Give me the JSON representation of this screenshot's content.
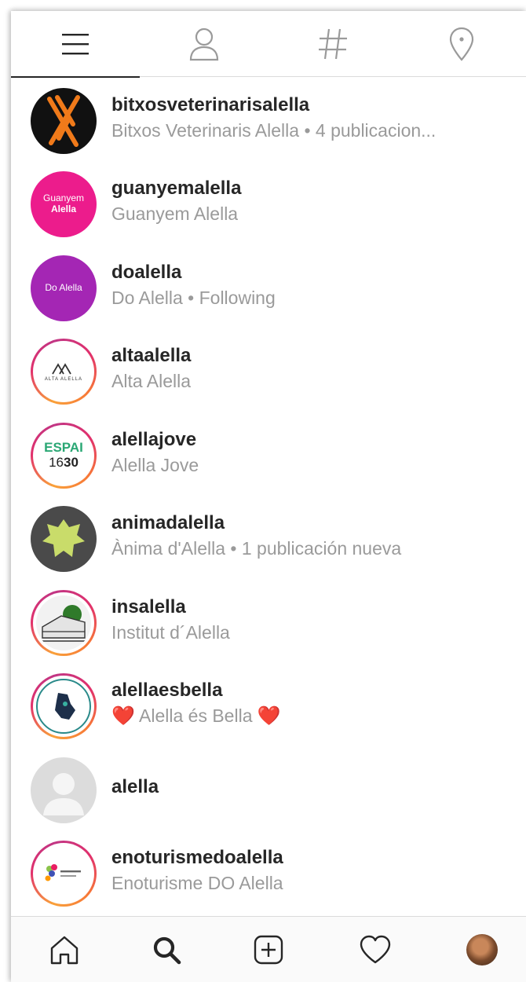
{
  "top_tabs": [
    {
      "id": "top",
      "icon": "menu-lines-icon",
      "active": true
    },
    {
      "id": "people",
      "icon": "person-icon",
      "active": false
    },
    {
      "id": "tags",
      "icon": "hashtag-icon",
      "active": false
    },
    {
      "id": "places",
      "icon": "location-pin-icon",
      "active": false
    }
  ],
  "results": [
    {
      "username": "bitxosveterinarisalella",
      "subtitle": "Bitxos Veterinaris Alella • 4 publicacion...",
      "ringed": false,
      "avatar_color": "#111111",
      "avatar_label": ""
    },
    {
      "username": "guanyemalella",
      "subtitle": "Guanyem Alella",
      "ringed": false,
      "avatar_color": "#ec1c8c",
      "avatar_label": "Guanyem Alella"
    },
    {
      "username": "doalella",
      "subtitle": "Do Alella • Following",
      "ringed": false,
      "avatar_color": "#a426b4",
      "avatar_label": "Do Alella"
    },
    {
      "username": "altaalella",
      "subtitle": "Alta Alella",
      "ringed": true,
      "avatar_color": "#ffffff",
      "avatar_label": "ALTA ALELLA"
    },
    {
      "username": "alellajove",
      "subtitle": "Alella Jove",
      "ringed": true,
      "avatar_color": "#ffffff",
      "avatar_label": "ESPAI 16·30"
    },
    {
      "username": "animadalella",
      "subtitle": "Ànima d'Alella • 1 publicación nueva",
      "ringed": false,
      "avatar_color": "#4a4a4a",
      "avatar_label": ""
    },
    {
      "username": "insalella",
      "subtitle": "Institut d´Alella",
      "ringed": true,
      "avatar_color": "#ffffff",
      "avatar_label": ""
    },
    {
      "username": "alellaesbella",
      "subtitle": "Alella és Bella",
      "ringed": true,
      "avatar_color": "#ffffff",
      "avatar_label": ""
    },
    {
      "username": "alella",
      "subtitle": "",
      "ringed": false,
      "avatar_color": "#dcdcdc",
      "avatar_label": ""
    },
    {
      "username": "enoturismedoalella",
      "subtitle": "Enoturisme DO Alella",
      "ringed": true,
      "avatar_color": "#ffffff",
      "avatar_label": ""
    }
  ],
  "bottom_nav": [
    {
      "id": "home",
      "icon": "home-icon"
    },
    {
      "id": "search",
      "icon": "search-icon",
      "active": true
    },
    {
      "id": "new-post",
      "icon": "plus-square-icon"
    },
    {
      "id": "activity",
      "icon": "heart-icon"
    },
    {
      "id": "profile",
      "icon": "profile-avatar"
    }
  ],
  "colors": {
    "text": "#262626",
    "subtext": "#9a9a9a",
    "divider": "#dbdbdb",
    "heart": "#e0142a"
  }
}
